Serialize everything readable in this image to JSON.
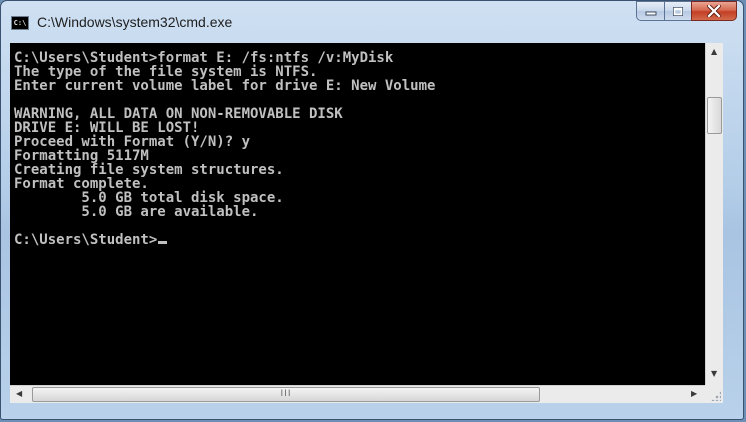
{
  "window": {
    "title": "C:\\Windows\\system32\\cmd.exe",
    "app_icon_text": "C:\\"
  },
  "caption_buttons": {
    "minimize_icon": "minimize-icon",
    "maximize_icon": "maximize-icon",
    "close_icon": "close-icon"
  },
  "console": {
    "text": "C:\\Users\\Student>format E: /fs:ntfs /v:MyDisk\nThe type of the file system is NTFS.\nEnter current volume label for drive E: New Volume\n\nWARNING, ALL DATA ON NON-REMOVABLE DISK\nDRIVE E: WILL BE LOST!\nProceed with Format (Y/N)? y\nFormatting 5117M\nCreating file system structures.\nFormat complete.\n        5.0 GB total disk space.\n        5.0 GB are available.\n\nC:\\Users\\Student>",
    "foreground": "#c0c0c0",
    "background": "#000000"
  },
  "scrollbars": {
    "up_arrow": "▲",
    "down_arrow": "▼",
    "left_arrow": "◀",
    "right_arrow": "▶",
    "grip": "III"
  },
  "colors": {
    "frame": "#b3cde8",
    "close_button": "#c23f25"
  }
}
